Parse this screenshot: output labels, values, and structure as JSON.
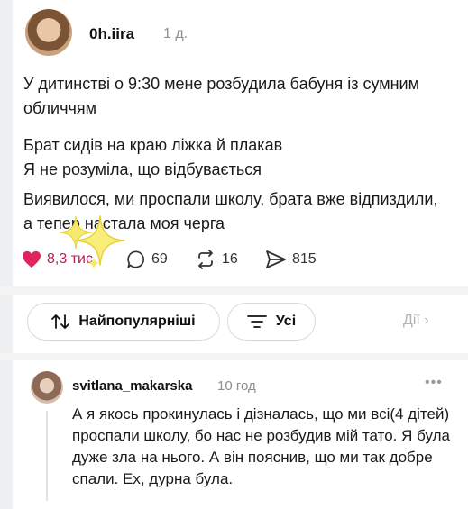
{
  "post": {
    "username": "0h.iira",
    "time": "1 д.",
    "paragraphs": [
      "У дитинстві о 9:30 мене розбудила бабуня із сумним обличчям",
      "Брат сидів на краю ліжка й плакав\nЯ не розуміла, що відбувається",
      "Виявилося, ми проспали школу, брата вже відпиздили, а тепер настала моя черга"
    ],
    "likes": "8,3 тис.",
    "comments": "69",
    "reposts": "16",
    "shares": "815"
  },
  "toolbar": {
    "sort_label": "Найпопулярніші",
    "filter_label": "Усі",
    "actions_label": "Дії"
  },
  "comment": {
    "username": "svitlana_makarska",
    "time": "10 год",
    "text": "А я якось прокинулась і дізналась, що ми всі(4 дітей) проспали школу, бо нас не розбудив мій тато. Я була дуже зла на нього. А він пояснив, що ми так добре спали. Ех, дурна була."
  },
  "colors": {
    "like": "#e0245e",
    "muted": "#8e8e8e",
    "sparkle": "#f3e05a"
  },
  "icons": [
    "heart-icon",
    "comment-icon",
    "repost-icon",
    "share-icon",
    "sort-icon",
    "filter-icon",
    "chevron-right-icon",
    "more-icon",
    "sparkle-icon"
  ]
}
